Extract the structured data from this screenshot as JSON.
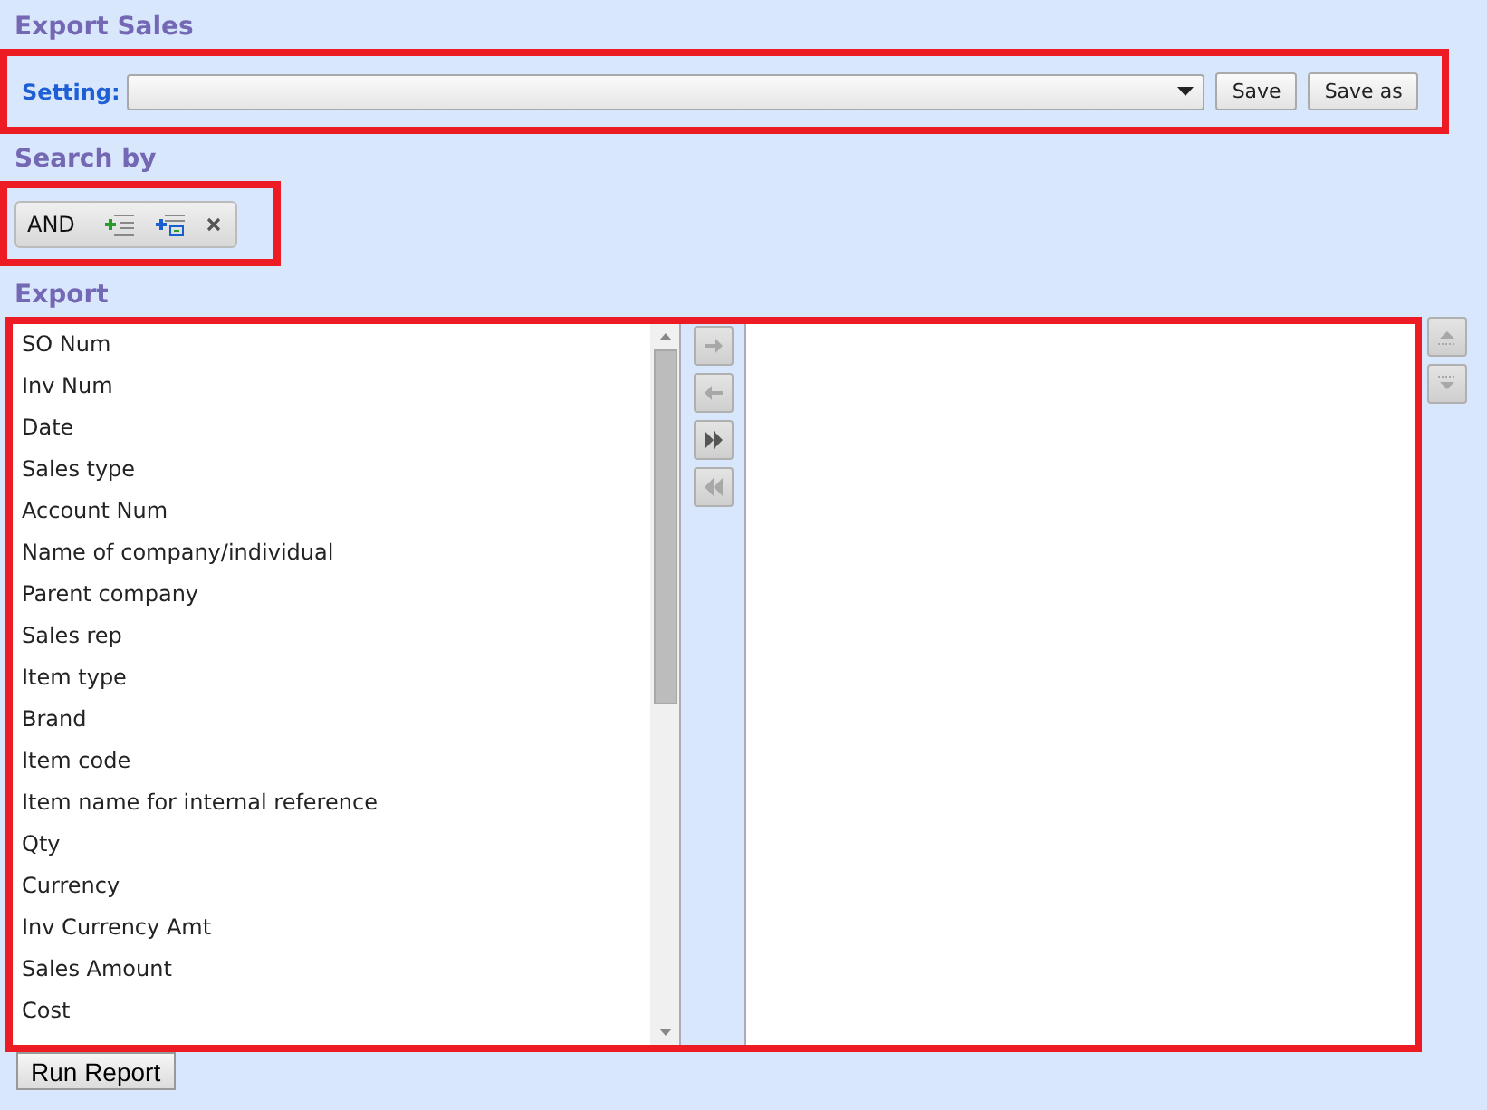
{
  "title": "Export Sales",
  "setting": {
    "label": "Setting:",
    "buttons": [
      "Save",
      "Save as"
    ]
  },
  "search_by": {
    "heading": "Search by",
    "operator": "AND",
    "tools": [
      {
        "kind": "add-condition"
      },
      {
        "kind": "add-group"
      },
      {
        "kind": "remove"
      }
    ]
  },
  "export": {
    "heading": "Export",
    "available_fields": [
      "SO Num",
      "Inv Num",
      "Date",
      "Sales type",
      "Account Num",
      "Name of company/individual",
      "Parent company",
      "Sales rep",
      "Item type",
      "Brand",
      "Item code",
      "Item name for internal reference",
      "Qty",
      "Currency",
      "Inv Currency Amt",
      "Sales Amount",
      "Cost"
    ],
    "transfer_buttons": [
      {
        "kind": "add",
        "disabled": true
      },
      {
        "kind": "remove",
        "disabled": true
      },
      {
        "kind": "add-all",
        "disabled": false
      },
      {
        "kind": "remove-all",
        "disabled": true
      }
    ],
    "order_buttons": [
      {
        "kind": "up",
        "disabled": true
      },
      {
        "kind": "down",
        "disabled": true
      }
    ]
  },
  "run_button": "Run Report"
}
